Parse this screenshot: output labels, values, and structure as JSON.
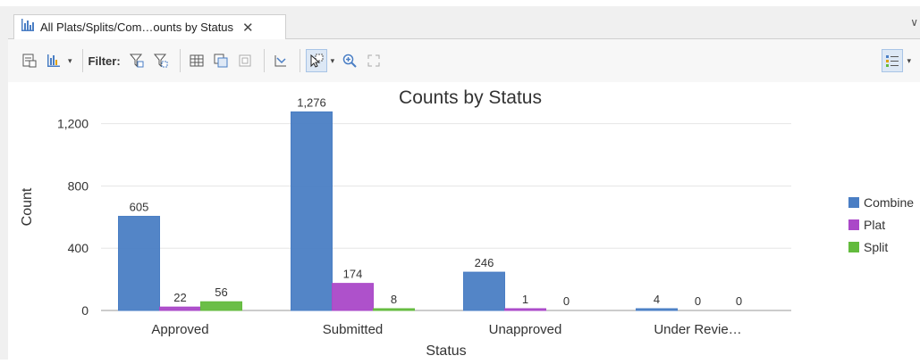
{
  "tab": {
    "title": "All Plats/Splits/Com…ounts by Status",
    "close_glyph": "✕",
    "menu_glyph": "∨"
  },
  "toolbar": {
    "filter_label": "Filter:"
  },
  "colors": {
    "Combined": "#4a7ec4",
    "Plat": "#aa48c8",
    "Split": "#63bb3d"
  },
  "chart_data": {
    "type": "bar",
    "title": "Counts by Status",
    "xlabel": "Status",
    "ylabel": "Count",
    "categories": [
      "Approved",
      "Submitted",
      "Unapproved",
      "Under Revie…"
    ],
    "series": [
      {
        "name": "Combine",
        "values": [
          605,
          1276,
          246,
          4
        ]
      },
      {
        "name": "Plat",
        "values": [
          22,
          174,
          1,
          0
        ]
      },
      {
        "name": "Split",
        "values": [
          56,
          8,
          0,
          0
        ]
      }
    ],
    "data_labels": [
      [
        "605",
        "1,276",
        "246",
        "4"
      ],
      [
        "22",
        "174",
        "1",
        "0"
      ],
      [
        "56",
        "8",
        "0",
        "0"
      ]
    ],
    "yticks": [
      0,
      400,
      800,
      1200
    ],
    "ytick_labels": [
      "0",
      "400",
      "800",
      "1,200"
    ],
    "ylim": [
      0,
      1330
    ],
    "grid": true,
    "legend_position": "right"
  }
}
